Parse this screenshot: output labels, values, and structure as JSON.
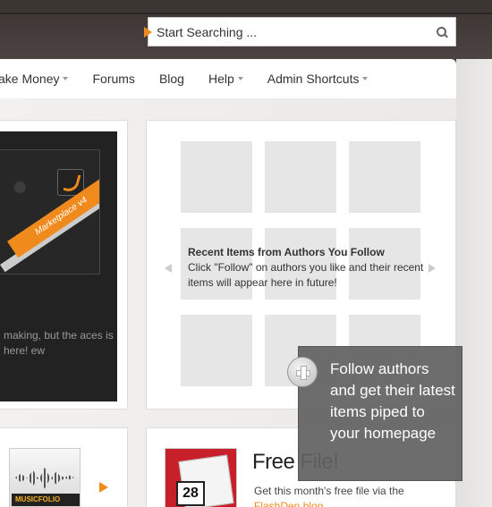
{
  "search": {
    "placeholder": "Start Searching ..."
  },
  "nav": {
    "items": [
      {
        "label": "ake Money",
        "has_dropdown": true
      },
      {
        "label": "Forums",
        "has_dropdown": false
      },
      {
        "label": "Blog",
        "has_dropdown": false
      },
      {
        "label": "Help",
        "has_dropdown": true
      },
      {
        "label": "Admin Shortcuts",
        "has_dropdown": true
      }
    ]
  },
  "promo": {
    "ribbon_text": "Marketplace v4",
    "text": "making, but the aces is here! ew"
  },
  "recent": {
    "title": "Recent Items from Authors You Follow",
    "description": "Click \"Follow\" on authors you like and their recent items will appear here in future!"
  },
  "tooltip": {
    "text": "Follow authors and get their latest items piped to your homepage"
  },
  "music": {
    "label": "MUSICFOLIO"
  },
  "free_file": {
    "title": "Free File!",
    "description": "Get this month's free file via the",
    "link": "FlashDen blog",
    "calendar_day": "28"
  },
  "colors": {
    "accent": "#f08a1c",
    "topbar": "#3a3431"
  }
}
